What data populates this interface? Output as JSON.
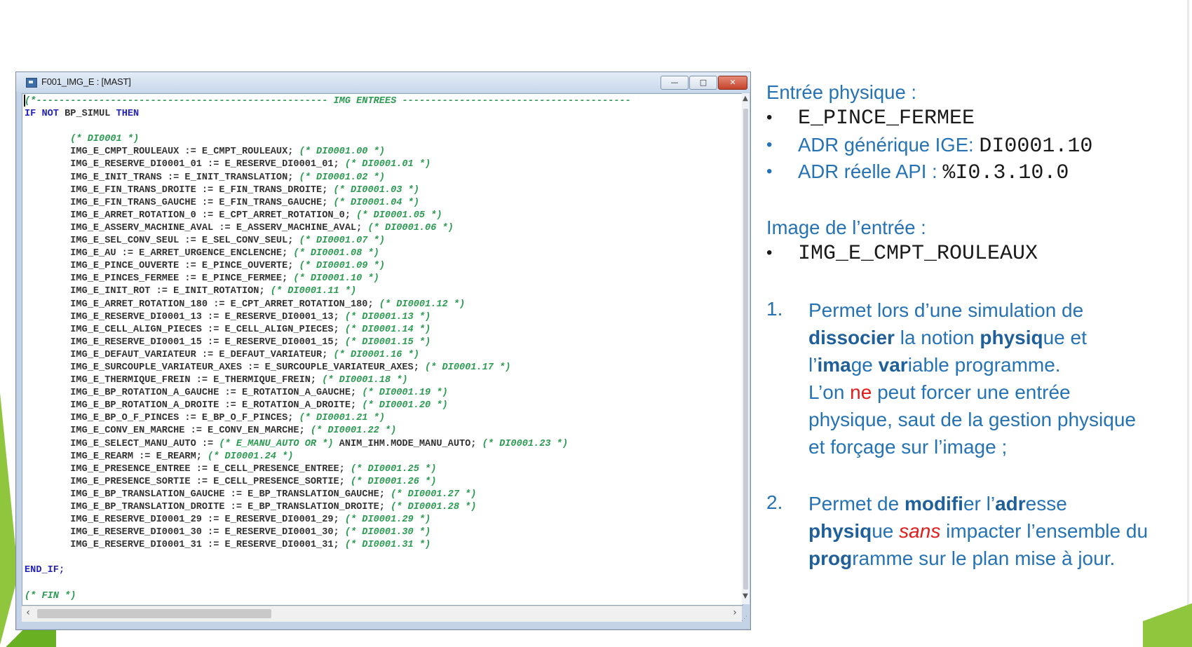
{
  "window": {
    "title": "F001_IMG_E : [MAST]",
    "buttons": {
      "minimize": "—",
      "maximize": "□",
      "close": "✕"
    }
  },
  "code": {
    "lines": [
      [
        {
          "t": "(*--------------------------------------------------- IMG ENTREES ----------------------------------------",
          "c": "cm"
        }
      ],
      [
        {
          "t": "IF ",
          "c": "kw"
        },
        {
          "t": "NOT ",
          "c": "kw"
        },
        {
          "t": "BP_SIMUL ",
          "c": ""
        },
        {
          "t": "THEN",
          "c": "kw"
        }
      ],
      [
        {
          "t": "",
          "c": ""
        }
      ],
      [
        {
          "t": "        ",
          "c": ""
        },
        {
          "t": "(* DI0001 *)",
          "c": "cm"
        }
      ],
      [
        {
          "t": "        IMG_E_CMPT_ROULEAUX := E_CMPT_ROULEAUX; ",
          "c": ""
        },
        {
          "t": "(* DI0001.00 *)",
          "c": "cm"
        }
      ],
      [
        {
          "t": "        IMG_E_RESERVE_DI0001_01 := E_RESERVE_DI0001_01; ",
          "c": ""
        },
        {
          "t": "(* DI0001.01 *)",
          "c": "cm"
        }
      ],
      [
        {
          "t": "        IMG_E_INIT_TRANS := E_INIT_TRANSLATION; ",
          "c": ""
        },
        {
          "t": "(* DI0001.02 *)",
          "c": "cm"
        }
      ],
      [
        {
          "t": "        IMG_E_FIN_TRANS_DROITE := E_FIN_TRANS_DROITE; ",
          "c": ""
        },
        {
          "t": "(* DI0001.03 *)",
          "c": "cm"
        }
      ],
      [
        {
          "t": "        IMG_E_FIN_TRANS_GAUCHE := E_FIN_TRANS_GAUCHE; ",
          "c": ""
        },
        {
          "t": "(* DI0001.04 *)",
          "c": "cm"
        }
      ],
      [
        {
          "t": "        IMG_E_ARRET_ROTATION_0 := E_CPT_ARRET_ROTATION_0; ",
          "c": ""
        },
        {
          "t": "(* DI0001.05 *)",
          "c": "cm"
        }
      ],
      [
        {
          "t": "        IMG_E_ASSERV_MACHINE_AVAL := E_ASSERV_MACHINE_AVAL; ",
          "c": ""
        },
        {
          "t": "(* DI0001.06 *)",
          "c": "cm"
        }
      ],
      [
        {
          "t": "        IMG_E_SEL_CONV_SEUL := E_SEL_CONV_SEUL; ",
          "c": ""
        },
        {
          "t": "(* DI0001.07 *)",
          "c": "cm"
        }
      ],
      [
        {
          "t": "        IMG_E_AU := E_ARRET_URGENCE_ENCLENCHE; ",
          "c": ""
        },
        {
          "t": "(* DI0001.08 *)",
          "c": "cm"
        }
      ],
      [
        {
          "t": "        IMG_E_PINCE_OUVERTE := E_PINCE_OUVERTE; ",
          "c": ""
        },
        {
          "t": "(* DI0001.09 *)",
          "c": "cm"
        }
      ],
      [
        {
          "t": "        IMG_E_PINCES_FERMEE := E_PINCE_FERMEE; ",
          "c": ""
        },
        {
          "t": "(* DI0001.10 *)",
          "c": "cm"
        }
      ],
      [
        {
          "t": "        IMG_E_INIT_ROT := E_INIT_ROTATION; ",
          "c": ""
        },
        {
          "t": "(* DI0001.11 *)",
          "c": "cm"
        }
      ],
      [
        {
          "t": "        IMG_E_ARRET_ROTATION_180 := E_CPT_ARRET_ROTATION_180; ",
          "c": ""
        },
        {
          "t": "(* DI0001.12 *)",
          "c": "cm"
        }
      ],
      [
        {
          "t": "        IMG_E_RESERVE_DI0001_13 := E_RESERVE_DI0001_13; ",
          "c": ""
        },
        {
          "t": "(* DI0001.13 *)",
          "c": "cm"
        }
      ],
      [
        {
          "t": "        IMG_E_CELL_ALIGN_PIECES := E_CELL_ALIGN_PIECES; ",
          "c": ""
        },
        {
          "t": "(* DI0001.14 *)",
          "c": "cm"
        }
      ],
      [
        {
          "t": "        IMG_E_RESERVE_DI0001_15 := E_RESERVE_DI0001_15; ",
          "c": ""
        },
        {
          "t": "(* DI0001.15 *)",
          "c": "cm"
        }
      ],
      [
        {
          "t": "        IMG_E_DEFAUT_VARIATEUR := E_DEFAUT_VARIATEUR; ",
          "c": ""
        },
        {
          "t": "(* DI0001.16 *)",
          "c": "cm"
        }
      ],
      [
        {
          "t": "        IMG_E_SURCOUPLE_VARIATEUR_AXES := E_SURCOUPLE_VARIATEUR_AXES; ",
          "c": ""
        },
        {
          "t": "(* DI0001.17 *)",
          "c": "cm"
        }
      ],
      [
        {
          "t": "        IMG_E_THERMIQUE_FREIN := E_THERMIQUE_FREIN; ",
          "c": ""
        },
        {
          "t": "(* DI0001.18 *)",
          "c": "cm"
        }
      ],
      [
        {
          "t": "        IMG_E_BP_ROTATION_A_GAUCHE := E_ROTATION_A_GAUCHE; ",
          "c": ""
        },
        {
          "t": "(* DI0001.19 *)",
          "c": "cm"
        }
      ],
      [
        {
          "t": "        IMG_E_BP_ROTATION_A_DROITE := E_ROTATION_A_DROITE; ",
          "c": ""
        },
        {
          "t": "(* DI0001.20 *)",
          "c": "cm"
        }
      ],
      [
        {
          "t": "        IMG_E_BP_O_F_PINCES := E_BP_O_F_PINCES; ",
          "c": ""
        },
        {
          "t": "(* DI0001.21 *)",
          "c": "cm"
        }
      ],
      [
        {
          "t": "        IMG_E_CONV_EN_MARCHE := E_CONV_EN_MARCHE; ",
          "c": ""
        },
        {
          "t": "(* DI0001.22 *)",
          "c": "cm"
        }
      ],
      [
        {
          "t": "        IMG_E_SELECT_MANU_AUTO := ",
          "c": ""
        },
        {
          "t": "(* E_MANU_AUTO OR *)",
          "c": "cm"
        },
        {
          "t": " ANIM_IHM.MODE_MANU_AUTO; ",
          "c": ""
        },
        {
          "t": "(* DI0001.23 *)",
          "c": "cm"
        }
      ],
      [
        {
          "t": "        IMG_E_REARM := E_REARM; ",
          "c": ""
        },
        {
          "t": "(* DI0001.24 *)",
          "c": "cm"
        }
      ],
      [
        {
          "t": "        IMG_E_PRESENCE_ENTREE := E_CELL_PRESENCE_ENTREE; ",
          "c": ""
        },
        {
          "t": "(* DI0001.25 *)",
          "c": "cm"
        }
      ],
      [
        {
          "t": "        IMG_E_PRESENCE_SORTIE := E_CELL_PRESENCE_SORTIE; ",
          "c": ""
        },
        {
          "t": "(* DI0001.26 *)",
          "c": "cm"
        }
      ],
      [
        {
          "t": "        IMG_E_BP_TRANSLATION_GAUCHE := E_BP_TRANSLATION_GAUCHE; ",
          "c": ""
        },
        {
          "t": "(* DI0001.27 *)",
          "c": "cm"
        }
      ],
      [
        {
          "t": "        IMG_E_BP_TRANSLATION_DROITE := E_BP_TRANSLATION_DROITE; ",
          "c": ""
        },
        {
          "t": "(* DI0001.28 *)",
          "c": "cm"
        }
      ],
      [
        {
          "t": "        IMG_E_RESERVE_DI0001_29 := E_RESERVE_DI0001_29; ",
          "c": ""
        },
        {
          "t": "(* DI0001.29 *)",
          "c": "cm"
        }
      ],
      [
        {
          "t": "        IMG_E_RESERVE_DI0001_30 := E_RESERVE_DI0001_30; ",
          "c": ""
        },
        {
          "t": "(* DI0001.30 *)",
          "c": "cm"
        }
      ],
      [
        {
          "t": "        IMG_E_RESERVE_DI0001_31 := E_RESERVE_DI0001_31; ",
          "c": ""
        },
        {
          "t": "(* DI0001.31 *)",
          "c": "cm"
        }
      ],
      [
        {
          "t": "",
          "c": ""
        }
      ],
      [
        {
          "t": "END_IF;",
          "c": "kw"
        }
      ],
      [
        {
          "t": "",
          "c": ""
        }
      ],
      [
        {
          "t": "(* FIN *)",
          "c": "cm"
        }
      ]
    ]
  },
  "panel": {
    "entree_heading": "Entrée physique :",
    "bullet1": "E_PINCE_FERMEE",
    "bullet2_label": "ADR générique IGE: ",
    "bullet2_value": "DI0001.10",
    "bullet3_label": "ADR réelle API : ",
    "bullet3_value": "%I0.3.10.0",
    "image_heading": "Image de l’entrée :",
    "bullet4": "IMG_E_CMPT_ROULEAUX",
    "item1_num": "1.",
    "item1": [
      [
        {
          "t": "Permet lors d’une simulation de",
          "s": ""
        }
      ],
      [
        {
          "t": "dissocier",
          "s": "b"
        },
        {
          "t": " la notion ",
          "s": ""
        },
        {
          "t": "physiq",
          "s": "b"
        },
        {
          "t": "ue et",
          "s": ""
        }
      ],
      [
        {
          "t": "l’",
          "s": ""
        },
        {
          "t": "ima",
          "s": "b"
        },
        {
          "t": "ge ",
          "s": ""
        },
        {
          "t": "var",
          "s": "b"
        },
        {
          "t": "iable programme.",
          "s": ""
        }
      ],
      [
        {
          "t": "L’on ",
          "s": ""
        },
        {
          "t": "ne",
          "s": "red"
        },
        {
          "t": " peut forcer une entrée",
          "s": ""
        }
      ],
      [
        {
          "t": "physique, saut de la gestion physique",
          "s": ""
        }
      ],
      [
        {
          "t": "et forçage sur l’image ;",
          "s": ""
        }
      ]
    ],
    "item2_num": "2.",
    "item2": [
      [
        {
          "t": "Permet de ",
          "s": ""
        },
        {
          "t": "modifi",
          "s": "b"
        },
        {
          "t": "er l’",
          "s": ""
        },
        {
          "t": "adr",
          "s": "b"
        },
        {
          "t": "esse",
          "s": ""
        }
      ],
      [
        {
          "t": "physiq",
          "s": "b"
        },
        {
          "t": "ue ",
          "s": ""
        },
        {
          "t": "sans",
          "s": "redi"
        },
        {
          "t": " impacter l’ensemble du",
          "s": ""
        }
      ],
      [
        {
          "t": "prog",
          "s": "b"
        },
        {
          "t": "ramme sur le plan mise à jour.",
          "s": ""
        }
      ]
    ]
  },
  "colors": {
    "accent": "#2572b5",
    "keyword": "#2323b8",
    "comment": "#2c9b52",
    "warning": "#e21b1b",
    "deco_green": "#8fc63e"
  }
}
